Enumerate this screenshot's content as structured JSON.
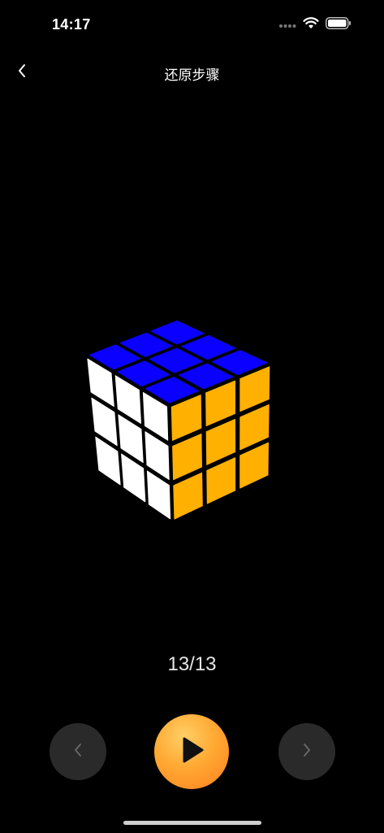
{
  "status_bar": {
    "time": "14:17",
    "icons": [
      "signal-dots-icon",
      "wifi-icon",
      "battery-icon"
    ]
  },
  "nav": {
    "title": "还原步骤",
    "back_icon": "chevron-left-icon"
  },
  "cube": {
    "faces": [
      "top",
      "left",
      "right"
    ],
    "colors": {
      "top": "#0a00ff",
      "left": "#ffffff",
      "right": "#ffb000"
    }
  },
  "step": {
    "counter": "13/13"
  },
  "controls": {
    "prev_icon": "chevron-left-icon",
    "play_icon": "play-icon",
    "next_icon": "chevron-right-icon",
    "play_colors": [
      "#ffcf66",
      "#ff7f1e"
    ]
  }
}
